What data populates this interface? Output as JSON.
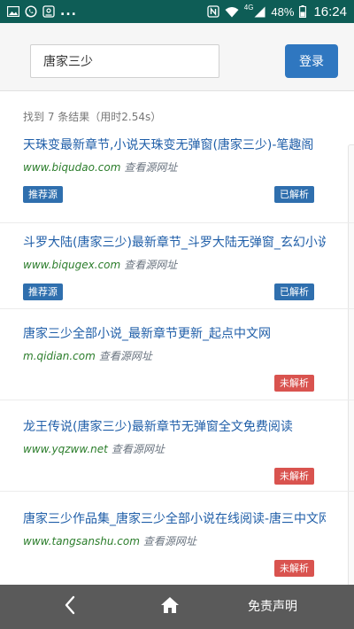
{
  "status_bar": {
    "left_icons": [
      "image-icon",
      "whatsapp-icon",
      "gallery-icon"
    ],
    "dots": "...",
    "right_icons": [
      "nfc-icon",
      "wifi-icon",
      "signal-icon",
      "battery-icon"
    ],
    "network": "4G",
    "battery": "48%",
    "time": "16:24"
  },
  "search": {
    "query": "唐家三少",
    "login_label": "登录"
  },
  "summary": "找到 7 条结果（用时2.54s）",
  "results": [
    {
      "title": "天珠变最新章节,小说天珠变无弹窗(唐家三少)-笔趣阁",
      "domain": "www.biqudao.com",
      "view_link": "查看源网址",
      "badge_left": "推荐源",
      "status": "已解析",
      "status_color": "#2f6fae"
    },
    {
      "title": "斗罗大陆(唐家三少)最新章节_斗罗大陆无弹窗_玄幻小说",
      "domain": "www.biqugex.com",
      "view_link": "查看源网址",
      "badge_left": "推荐源",
      "status": "已解析",
      "status_color": "#2f6fae"
    },
    {
      "title": "唐家三少全部小说_最新章节更新_起点中文网",
      "domain": "m.qidian.com",
      "view_link": "查看源网址",
      "badge_left": "",
      "status": "未解析",
      "status_color": "#d9534f"
    },
    {
      "title": "龙王传说(唐家三少)最新章节无弹窗全文免费阅读",
      "domain": "www.yqzww.net",
      "view_link": "查看源网址",
      "badge_left": "",
      "status": "未解析",
      "status_color": "#d9534f"
    },
    {
      "title": "唐家三少作品集_唐家三少全部小说在线阅读-唐三中文网",
      "domain": "www.tangsanshu.com",
      "view_link": "查看源网址",
      "badge_left": "",
      "status": "未解析",
      "status_color": "#d9534f"
    }
  ],
  "bottom_bar": {
    "back_icon": "chevron-left-icon",
    "home_icon": "home-icon",
    "disclaimer": "免责声明"
  },
  "colors": {
    "status_bar": "#0e5d56",
    "accent": "#2f77c0",
    "link": "#1f5ea8",
    "domain": "#2b7d2b",
    "parsed": "#2f6fae",
    "unparsed": "#d9534f",
    "bottom_bar": "#5a5a5a"
  }
}
